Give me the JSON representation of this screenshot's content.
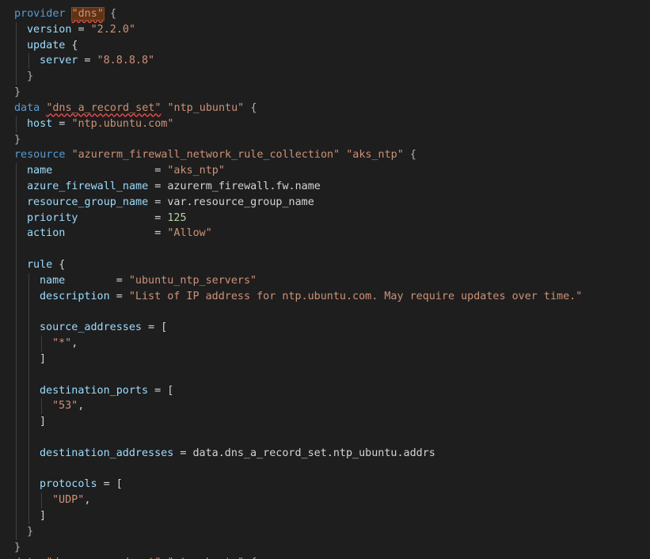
{
  "editor": {
    "language": "terraform",
    "colors": {
      "background": "#1e1e1e",
      "keyword": "#569cd6",
      "attribute": "#9cdcfe",
      "string": "#ce9178",
      "number": "#b5cea8",
      "punctuation": "#d4d4d4",
      "error_squiggle": "#f14c4c",
      "bracket_highlight": "#613214"
    },
    "lines": [
      {
        "indent": 0,
        "tokens": [
          {
            "t": "provider",
            "k": "keyword"
          },
          {
            "t": " ",
            "k": "plain"
          },
          {
            "t": "\"dns\"",
            "k": "string",
            "err": true,
            "hl": true
          },
          {
            "t": " ",
            "k": "plain"
          },
          {
            "t": "{",
            "k": "bracket"
          }
        ]
      },
      {
        "indent": 1,
        "tokens": [
          {
            "t": "version",
            "k": "attr"
          },
          {
            "t": " = ",
            "k": "op"
          },
          {
            "t": "\"2.2.0\"",
            "k": "string"
          }
        ]
      },
      {
        "indent": 1,
        "tokens": [
          {
            "t": "update",
            "k": "attr"
          },
          {
            "t": " {",
            "k": "punct"
          }
        ]
      },
      {
        "indent": 2,
        "tokens": [
          {
            "t": "server",
            "k": "attr"
          },
          {
            "t": " = ",
            "k": "op"
          },
          {
            "t": "\"8.8.8.8\"",
            "k": "string"
          }
        ]
      },
      {
        "indent": 1,
        "tokens": [
          {
            "t": "}",
            "k": "bracket"
          }
        ]
      },
      {
        "indent": 0,
        "tokens": [
          {
            "t": "}",
            "k": "bracket"
          }
        ]
      },
      {
        "indent": 0,
        "tokens": [
          {
            "t": "data",
            "k": "keyword"
          },
          {
            "t": " ",
            "k": "plain"
          },
          {
            "t": "\"dns_a_record_set\"",
            "k": "string",
            "err": true
          },
          {
            "t": " ",
            "k": "plain"
          },
          {
            "t": "\"ntp_ubuntu\"",
            "k": "string"
          },
          {
            "t": " ",
            "k": "plain"
          },
          {
            "t": "{",
            "k": "bracket"
          }
        ]
      },
      {
        "indent": 1,
        "tokens": [
          {
            "t": "host",
            "k": "attr"
          },
          {
            "t": " = ",
            "k": "op"
          },
          {
            "t": "\"ntp.ubuntu.com\"",
            "k": "string"
          }
        ]
      },
      {
        "indent": 0,
        "tokens": [
          {
            "t": "}",
            "k": "bracket"
          }
        ]
      },
      {
        "indent": 0,
        "tokens": [
          {
            "t": "resource",
            "k": "keyword"
          },
          {
            "t": " ",
            "k": "plain"
          },
          {
            "t": "\"azurerm_firewall_network_rule_collection\"",
            "k": "string"
          },
          {
            "t": " ",
            "k": "plain"
          },
          {
            "t": "\"aks_ntp\"",
            "k": "string"
          },
          {
            "t": " ",
            "k": "plain"
          },
          {
            "t": "{",
            "k": "bracket"
          }
        ]
      },
      {
        "indent": 1,
        "tokens": [
          {
            "t": "name",
            "k": "attr"
          },
          {
            "t": "                = ",
            "k": "op"
          },
          {
            "t": "\"aks_ntp\"",
            "k": "string"
          }
        ]
      },
      {
        "indent": 1,
        "tokens": [
          {
            "t": "azure_firewall_name",
            "k": "attr"
          },
          {
            "t": " = ",
            "k": "op"
          },
          {
            "t": "azurerm_firewall.fw.name",
            "k": "plain"
          }
        ]
      },
      {
        "indent": 1,
        "tokens": [
          {
            "t": "resource_group_name",
            "k": "attr"
          },
          {
            "t": " = ",
            "k": "op"
          },
          {
            "t": "var.resource_group_name",
            "k": "plain"
          }
        ]
      },
      {
        "indent": 1,
        "tokens": [
          {
            "t": "priority",
            "k": "attr"
          },
          {
            "t": "            = ",
            "k": "op"
          },
          {
            "t": "125",
            "k": "number"
          }
        ]
      },
      {
        "indent": 1,
        "tokens": [
          {
            "t": "action",
            "k": "attr"
          },
          {
            "t": "              = ",
            "k": "op"
          },
          {
            "t": "\"Allow\"",
            "k": "string"
          }
        ]
      },
      {
        "indent": 1,
        "tokens": []
      },
      {
        "indent": 1,
        "tokens": [
          {
            "t": "rule",
            "k": "attr"
          },
          {
            "t": " {",
            "k": "punct"
          }
        ]
      },
      {
        "indent": 2,
        "tokens": [
          {
            "t": "name",
            "k": "attr"
          },
          {
            "t": "        = ",
            "k": "op"
          },
          {
            "t": "\"ubuntu_ntp_servers\"",
            "k": "string"
          }
        ]
      },
      {
        "indent": 2,
        "tokens": [
          {
            "t": "description",
            "k": "attr"
          },
          {
            "t": " = ",
            "k": "op"
          },
          {
            "t": "\"List of IP address for ntp.ubuntu.com. May require updates over time.\"",
            "k": "string"
          }
        ]
      },
      {
        "indent": 2,
        "tokens": []
      },
      {
        "indent": 2,
        "tokens": [
          {
            "t": "source_addresses",
            "k": "attr"
          },
          {
            "t": " = [",
            "k": "op"
          }
        ]
      },
      {
        "indent": 3,
        "tokens": [
          {
            "t": "\"*\"",
            "k": "string"
          },
          {
            "t": ",",
            "k": "punct"
          }
        ]
      },
      {
        "indent": 2,
        "tokens": [
          {
            "t": "]",
            "k": "punct"
          }
        ]
      },
      {
        "indent": 2,
        "tokens": []
      },
      {
        "indent": 2,
        "tokens": [
          {
            "t": "destination_ports",
            "k": "attr"
          },
          {
            "t": " = [",
            "k": "op"
          }
        ]
      },
      {
        "indent": 3,
        "tokens": [
          {
            "t": "\"53\"",
            "k": "string"
          },
          {
            "t": ",",
            "k": "punct"
          }
        ]
      },
      {
        "indent": 2,
        "tokens": [
          {
            "t": "]",
            "k": "punct"
          }
        ]
      },
      {
        "indent": 2,
        "tokens": []
      },
      {
        "indent": 2,
        "tokens": [
          {
            "t": "destination_addresses",
            "k": "attr"
          },
          {
            "t": " = ",
            "k": "op"
          },
          {
            "t": "data.dns_a_record_set.ntp_ubuntu.addrs",
            "k": "plain"
          }
        ]
      },
      {
        "indent": 2,
        "tokens": []
      },
      {
        "indent": 2,
        "tokens": [
          {
            "t": "protocols",
            "k": "attr"
          },
          {
            "t": " = [",
            "k": "op"
          }
        ]
      },
      {
        "indent": 3,
        "tokens": [
          {
            "t": "\"UDP\"",
            "k": "string"
          },
          {
            "t": ",",
            "k": "punct"
          }
        ]
      },
      {
        "indent": 2,
        "tokens": [
          {
            "t": "]",
            "k": "punct"
          }
        ]
      },
      {
        "indent": 1,
        "tokens": [
          {
            "t": "}",
            "k": "bracket"
          }
        ]
      },
      {
        "indent": 0,
        "tokens": [
          {
            "t": "}",
            "k": "bracket"
          }
        ]
      },
      {
        "indent": 0,
        "tokens": [
          {
            "t": "data",
            "k": "keyword"
          },
          {
            "t": " ",
            "k": "plain"
          },
          {
            "t": "\"dns_a_record_set\"",
            "k": "string"
          },
          {
            "t": " ",
            "k": "plain"
          },
          {
            "t": "\"ntp_ubuntu\"",
            "k": "string"
          },
          {
            "t": " ",
            "k": "plain"
          },
          {
            "t": "{",
            "k": "bracket"
          }
        ]
      }
    ]
  }
}
